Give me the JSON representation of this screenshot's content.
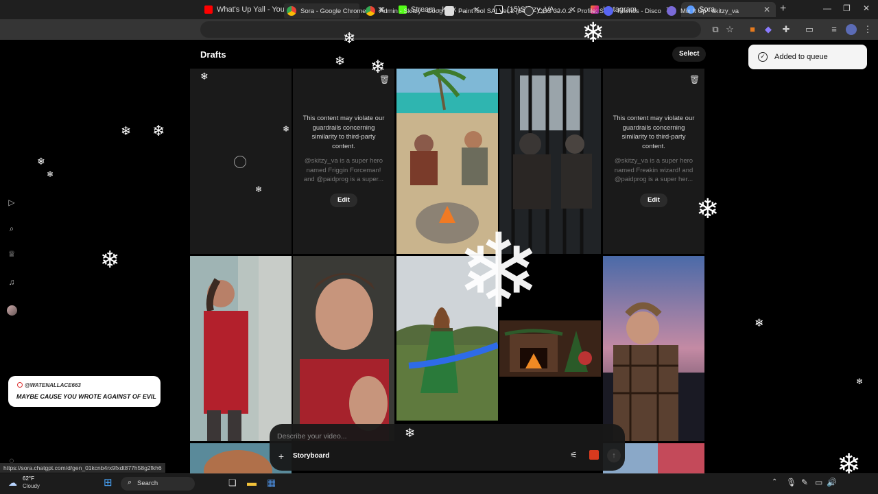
{
  "browser": {
    "tabs": [
      {
        "title": "What's Up Yall - YouTube",
        "icon": "youtube-icon",
        "color": "#ff0000"
      },
      {
        "title": "Twitch",
        "icon": "twitch-icon",
        "color": "#9146ff"
      },
      {
        "title": "Stream - Kick Dashboard",
        "icon": "kick-icon",
        "color": "#53fc18"
      },
      {
        "title": "(15)Skitzy_VA / Watch and",
        "icon": "tiktok-icon",
        "color": "#ffffff"
      },
      {
        "title": "Instagram",
        "icon": "instagram-icon",
        "color": "#e1306c"
      },
      {
        "title": "Sora",
        "icon": "sora-icon",
        "color": "#5b9cff"
      }
    ],
    "active_tab": "Sora",
    "new_tab_symbol": "+",
    "status_url": "https://sora.chatgpt.com/d/gen_01kcnb4rx9fxdt877h58g2fkh6"
  },
  "page": {
    "title": "Drafts",
    "select_label": "Select",
    "toast": "Added to queue",
    "blocked_message": "This content may violate our guardrails concerning similarity to third-party content.",
    "drafts_blocked": [
      {
        "prompt": "@skitzy_va is a super hero named Friggin Forceman! and @paidprog is a super..."
      },
      {
        "prompt": "@skitzy_va is a super hero named Freakin wizard! and @paidprog is a super her..."
      }
    ],
    "edit_label": "Edit",
    "prompt_placeholder": "Describe your video...",
    "storyboard_label": "Storyboard"
  },
  "chat_overlay": {
    "username": "@WATENALLACE663",
    "message": "MAYBE CAUSE YOU WROTE AGAINST OF EVIL"
  },
  "taskbar": {
    "temp": "62°F",
    "condition": "Cloudy",
    "search_label": "Search",
    "items": [
      {
        "label": "Sora - Google Chrome",
        "icon": "chrome-icon"
      },
      {
        "label": "Admin - Skitzy - Goog",
        "icon": "chrome-icon"
      },
      {
        "label": "PaintTool SAI Ver.2 (64",
        "icon": "painttool-icon"
      },
      {
        "label": "OBS 32.0.2 - Profile: St",
        "icon": "obs-icon"
      },
      {
        "label": "Friends - Discord",
        "icon": "discord-icon"
      },
      {
        "label": "Mix It Up - skitzy_va -",
        "icon": "mixitup-icon"
      }
    ]
  },
  "colors": {
    "page_bg": "#000000",
    "cell_dark": "#1a1a1a",
    "toast_bg": "#f4f4f4",
    "tab_active": "#353535"
  }
}
